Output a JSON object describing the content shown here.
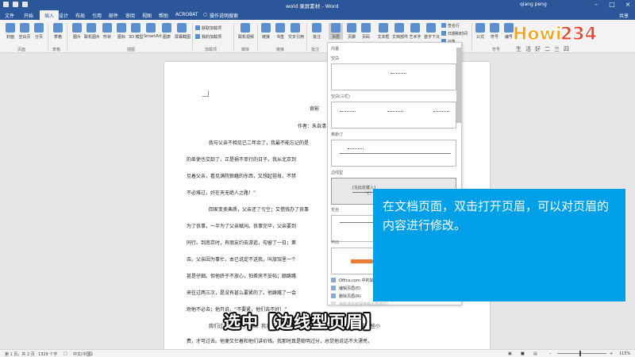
{
  "window": {
    "title": "wold 录屏素材 - Word",
    "user": "qiang peng",
    "share_label": "共享"
  },
  "tabs": [
    {
      "label": "文件"
    },
    {
      "label": "开始"
    },
    {
      "label": "插入",
      "active": true
    },
    {
      "label": "设计"
    },
    {
      "label": "布局"
    },
    {
      "label": "引用"
    },
    {
      "label": "邮件"
    },
    {
      "label": "审阅"
    },
    {
      "label": "视图"
    },
    {
      "label": "帮助"
    },
    {
      "label": "ACROBAT"
    },
    {
      "label": "操作说明搜索"
    }
  ],
  "ribbon": {
    "buttons": [
      {
        "label": "封面"
      },
      {
        "label": "空白页"
      },
      {
        "label": "分页"
      },
      {
        "label": "表格"
      },
      {
        "label": "图片"
      },
      {
        "label": "联机图片"
      },
      {
        "label": "形状"
      },
      {
        "label": "图标"
      },
      {
        "label": "3D 模型"
      },
      {
        "label": "SmartArt"
      },
      {
        "label": "图表"
      },
      {
        "label": "屏幕截图"
      },
      {
        "label": "联机视频"
      },
      {
        "label": "链接"
      },
      {
        "label": "书签"
      },
      {
        "label": "交叉引用"
      },
      {
        "label": "批注"
      },
      {
        "label": "页眉"
      },
      {
        "label": "页脚"
      },
      {
        "label": "页码"
      },
      {
        "label": "文本框"
      },
      {
        "label": "文档部件"
      },
      {
        "label": "艺术字"
      },
      {
        "label": "首字下沉"
      },
      {
        "label": "公式"
      },
      {
        "label": "符号"
      },
      {
        "label": "编号"
      }
    ],
    "addins": [
      "获取加载项",
      "我的加载项"
    ],
    "text_small": [
      "签名行",
      "日期和时间",
      "对象"
    ],
    "groups": [
      "页面",
      "表格",
      "插图",
      "加载项",
      "媒体",
      "链接",
      "批注",
      "符号"
    ]
  },
  "logo": {
    "text": "Howi234",
    "subtitle": "生活好二三四"
  },
  "document": {
    "title": "背影",
    "author": "作者：朱自清",
    "lines": [
      "我与父亲不相见已二年余了，我最不能忘记的是",
      "的差使也交卸了，正是祸不单行的日子，我从北京到",
      "见着父亲，看见满院狼藉的东西，又想起祖母，不禁",
      "不必难过，好在天无绝人之路！”",
      "回家变卖典质，父亲还了亏空；又借钱办了丧事",
      "为了丧事，一半为了父亲赋闲。丧事完毕，父亲要到",
      "同行。到南京时，有朋友约去游逛，勾留了一日；第",
      "去。父亲因为事忙，本已说定不送我，叫旅馆里一个",
      "甚是仔细。但他终于不放心，怕茶房不妥帖；颇踌躇",
      "来往过两三次，是没有甚么要紧的了。他踌躇了一会",
      "劝他不必去；他只说，“不要紧，他们去不好！”",
      "我们过了江，进了车站。我买票，他忙着照看行李。行李太多了，得向脚夫行些小",
      "费，才可过去。他便又忙着和他们讲价钱。我那时真是聪明过分，总觉他说话不大漂亮，"
    ]
  },
  "header_gallery": {
    "section_label": "内置",
    "items": [
      {
        "label": "空白"
      },
      {
        "label": "空白(三栏)"
      },
      {
        "label": "奥斯汀"
      },
      {
        "label": "边线型",
        "selected": true
      },
      {
        "label": "花丝"
      },
      {
        "label": "怀旧"
      }
    ],
    "placeholder": "[在此处键入]",
    "menu": [
      {
        "label": "Office.com 中的其他页眉",
        "disabled": false
      },
      {
        "label": "编辑页眉(E)",
        "disabled": false
      },
      {
        "label": "删除页眉(R)",
        "disabled": false
      },
      {
        "label": "将所选内容保存到页眉库(S)...",
        "disabled": true
      }
    ]
  },
  "overlay": {
    "text": "在文档页面，双击打开页眉，可以对页眉的内容进行修改。"
  },
  "caption": "选中【边线型页眉】",
  "status": {
    "page": "第 1 页，共 2 页",
    "words": "1329 个字",
    "language": "中文(中国)",
    "zoom": "115%"
  }
}
